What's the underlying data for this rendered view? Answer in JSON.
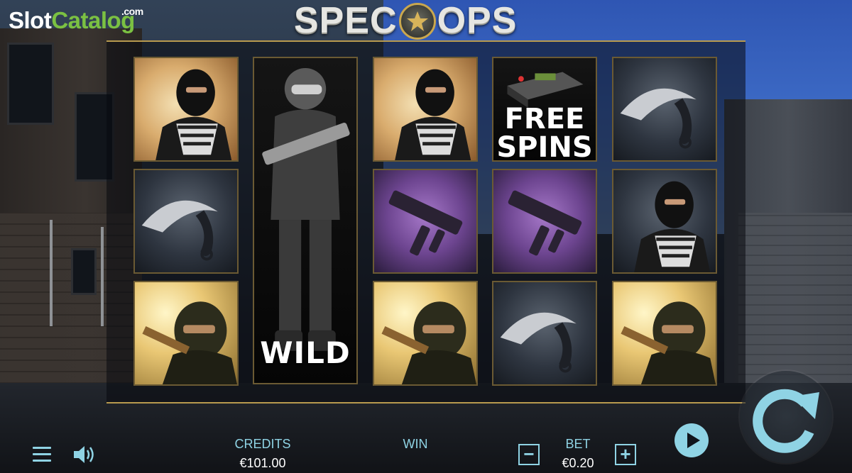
{
  "watermark": {
    "slot": "Slot",
    "catalog": "Catalog",
    "com": ".com"
  },
  "game_title": {
    "left": "SPEC",
    "right": "OPS"
  },
  "reels": [
    [
      {
        "symbol": "masked-man",
        "bg": "orange"
      },
      {
        "symbol": "knife",
        "bg": "dark"
      },
      {
        "symbol": "sniper",
        "bg": "yellow"
      }
    ],
    [
      {
        "symbol": "wild-soldier",
        "bg": "black",
        "label": "WILD"
      }
    ],
    [
      {
        "symbol": "masked-man",
        "bg": "orange"
      },
      {
        "symbol": "smg",
        "bg": "purple"
      },
      {
        "symbol": "sniper",
        "bg": "yellow"
      }
    ],
    [
      {
        "symbol": "free-spins-bomb",
        "bg": "black",
        "label_line1": "FREE",
        "label_line2": "SPINS"
      },
      {
        "symbol": "smg",
        "bg": "purple"
      },
      {
        "symbol": "knife",
        "bg": "dark"
      }
    ],
    [
      {
        "symbol": "knife",
        "bg": "dark"
      },
      {
        "symbol": "masked-man",
        "bg": "dark"
      },
      {
        "symbol": "sniper",
        "bg": "yellow"
      }
    ]
  ],
  "hud": {
    "credits_label": "CREDITS",
    "credits_value": "€101.00",
    "win_label": "WIN",
    "win_value": "",
    "bet_label": "BET",
    "bet_value": "€0.20",
    "minus": "−",
    "plus": "+"
  },
  "colors": {
    "accent": "#8fd3e4",
    "gold": "#b89a4e",
    "watermark_green": "#7bc142"
  },
  "icons": [
    "menu-icon",
    "sound-icon",
    "minus-icon",
    "plus-icon",
    "play-icon",
    "spin-icon"
  ]
}
